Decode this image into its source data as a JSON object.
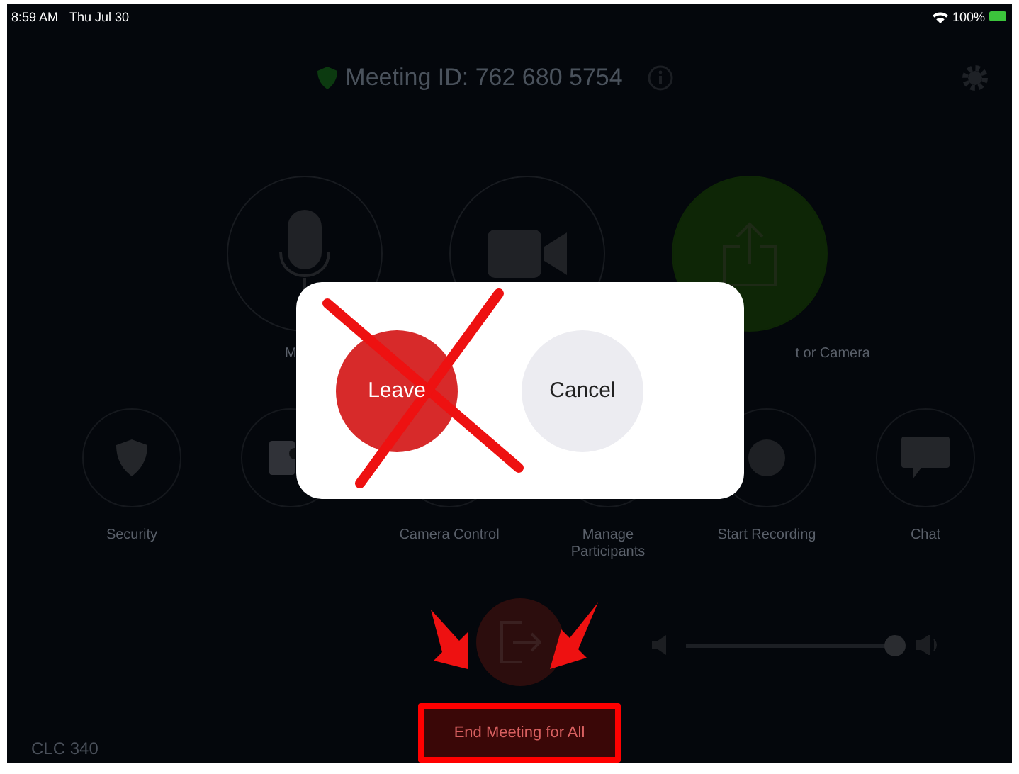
{
  "status_bar": {
    "time": "8:59 AM",
    "date": "Thu Jul 30",
    "battery": "100%"
  },
  "header": {
    "meeting_id": "Meeting ID: 762 680 5754"
  },
  "main_controls": [
    {
      "kind": "mic",
      "label": "M"
    },
    {
      "kind": "video"
    },
    {
      "kind": "share",
      "label": "t or Camera"
    }
  ],
  "secondary_controls": [
    {
      "kind": "security",
      "label": "Security"
    },
    {
      "kind": "photo"
    },
    {
      "kind": "camera",
      "label": "Camera Control"
    },
    {
      "kind": "participants",
      "label": "Manage Participants"
    },
    {
      "kind": "record",
      "label": "Start Recording"
    },
    {
      "kind": "chat",
      "label": "Chat"
    }
  ],
  "end_button": {
    "label": "End Meeting for All"
  },
  "volume_slider": {
    "level": 0.97
  },
  "room_name": "CLC 340",
  "dialog": {
    "buttons": [
      {
        "kind": "leave",
        "label": "Leave"
      },
      {
        "kind": "cancel",
        "label": "Cancel"
      }
    ]
  }
}
